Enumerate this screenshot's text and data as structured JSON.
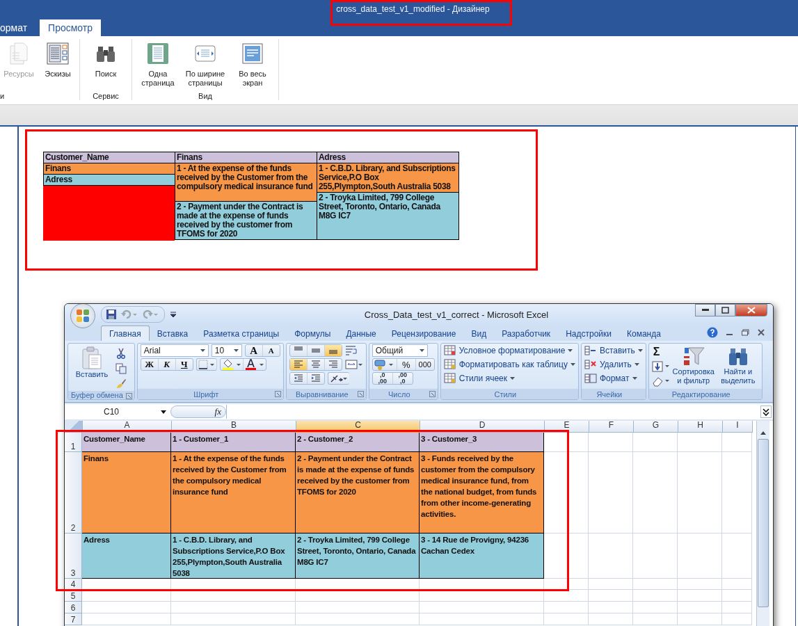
{
  "designer": {
    "title": "cross_data_test_v1_modified - Дизайнер",
    "tabs": [
      {
        "label": "ормат",
        "selected": false
      },
      {
        "label": "Просмотр",
        "selected": true
      }
    ],
    "ribbon_groups": [
      {
        "label": "и",
        "buttons": [
          {
            "label": "Ресурсы",
            "disabled": true
          },
          {
            "label": "Эскизы",
            "disabled": false
          }
        ]
      },
      {
        "label": "Сервис",
        "buttons": [
          {
            "label": "Поиск",
            "disabled": false
          }
        ]
      },
      {
        "label": "Вид",
        "buttons": [
          {
            "label": "Одна страница",
            "disabled": false
          },
          {
            "label": "По ширине страницы",
            "disabled": false
          },
          {
            "label": "Во весь экран",
            "disabled": false
          }
        ]
      }
    ]
  },
  "report": {
    "header": [
      "Customer_Name",
      "Finans",
      "Adress"
    ],
    "row_labels": [
      {
        "text": "Finans",
        "color": "#f79646"
      },
      {
        "text": "Adress",
        "color": "#92cddc"
      }
    ],
    "finans": [
      {
        "text": "1 - At the expense of the funds received by the Customer from the compulsory medical insurance fund",
        "color": "#f79646"
      },
      {
        "text": "2 - Payment under the Contract is made at the expense of funds received by the customer from TFOMS for 2020",
        "color": "#92cddc"
      }
    ],
    "adress": [
      {
        "text": "1 - C.B.D. Library, and Subscriptions Service,P.O Box 255,Plympton,South Australia 5038",
        "color": "#f79646"
      },
      {
        "text": "2 - Troyka Limited, 799 College Street, Toronto, Ontario, Canada M8G IC7",
        "color": "#92cddc"
      }
    ]
  },
  "excel": {
    "title": "Cross_Data_test_v1_correct - Microsoft Excel",
    "tabs": [
      {
        "label": "Главная",
        "selected": true
      },
      {
        "label": "Вставка",
        "selected": false
      },
      {
        "label": "Разметка страницы",
        "selected": false
      },
      {
        "label": "Формулы",
        "selected": false
      },
      {
        "label": "Данные",
        "selected": false
      },
      {
        "label": "Рецензирование",
        "selected": false
      },
      {
        "label": "Вид",
        "selected": false
      },
      {
        "label": "Разработчик",
        "selected": false
      },
      {
        "label": "Надстройки",
        "selected": false
      },
      {
        "label": "Команда",
        "selected": false
      }
    ],
    "clipboard": {
      "paste": "Вставить",
      "label": "Буфер обмена"
    },
    "font": {
      "name": "Arial",
      "size": "10",
      "grow": "A",
      "shrink": "A",
      "bold": "Ж",
      "italic": "К",
      "underline": "Ч",
      "label": "Шрифт"
    },
    "alignment": {
      "label": "Выравнивание",
      "vertical": [
        {
          "selected": false
        },
        {
          "selected": false
        },
        {
          "selected": true
        }
      ],
      "horizontal": [
        {
          "selected": true
        },
        {
          "selected": false
        },
        {
          "selected": false
        }
      ]
    },
    "number": {
      "format": "Общий",
      "percent": "%",
      "thousands": "000",
      "increase": [
        ",0",
        ",00"
      ],
      "decrease": [
        ",00",
        ",0"
      ],
      "label": "Число"
    },
    "styles": {
      "items": [
        "Условное форматирование",
        "Форматировать как таблицу",
        "Стили ячеек"
      ],
      "label": "Стили"
    },
    "cells": {
      "items": [
        "Вставить",
        "Удалить",
        "Формат"
      ],
      "label": "Ячейки"
    },
    "editing": {
      "sum": "Σ",
      "sort": "Сортировка и фильтр",
      "find": "Найти и выделить",
      "label": "Редактирование"
    },
    "name_box": "C10",
    "fx": "fx",
    "columns": [
      {
        "label": "A",
        "selected": false
      },
      {
        "label": "B",
        "selected": false
      },
      {
        "label": "C",
        "selected": true
      },
      {
        "label": "D",
        "selected": false
      },
      {
        "label": "E",
        "selected": false
      },
      {
        "label": "F",
        "selected": false
      },
      {
        "label": "G",
        "selected": false
      },
      {
        "label": "H",
        "selected": false
      },
      {
        "label": "I",
        "selected": false
      }
    ],
    "rows": [
      {
        "number": "1",
        "color": "#ccc0da",
        "cells": [
          "Customer_Name",
          "1 - Customer_1",
          "2 - Customer_2",
          "3 - Customer_3"
        ]
      },
      {
        "number": "2",
        "color": "#f79646",
        "cells": [
          "Finans",
          "1 - At the expense of the funds received by the Customer from the compulsory medical insurance fund",
          "2 - Payment under the Contract is made at the expense of funds received by the customer from TFOMS for 2020",
          "3 - Funds received by the customer from the compulsory medical insurance fund, from the national budget, from funds from other income-generating activities."
        ]
      },
      {
        "number": "3",
        "color": "#92cddc",
        "cells": [
          "Adress",
          "1 - C.B.D. Library, and Subscriptions Service,P.O Box 255,Plympton,South Australia 5038",
          "2 - Troyka Limited, 799 College Street, Toronto, Ontario, Canada M8G IC7",
          "3 - 14 Rue de Provigny, 94236 Cachan Cedex"
        ]
      },
      {
        "number": "4",
        "cells": []
      },
      {
        "number": "5",
        "cells": []
      },
      {
        "number": "6",
        "cells": []
      },
      {
        "number": "7",
        "cells": []
      }
    ]
  }
}
